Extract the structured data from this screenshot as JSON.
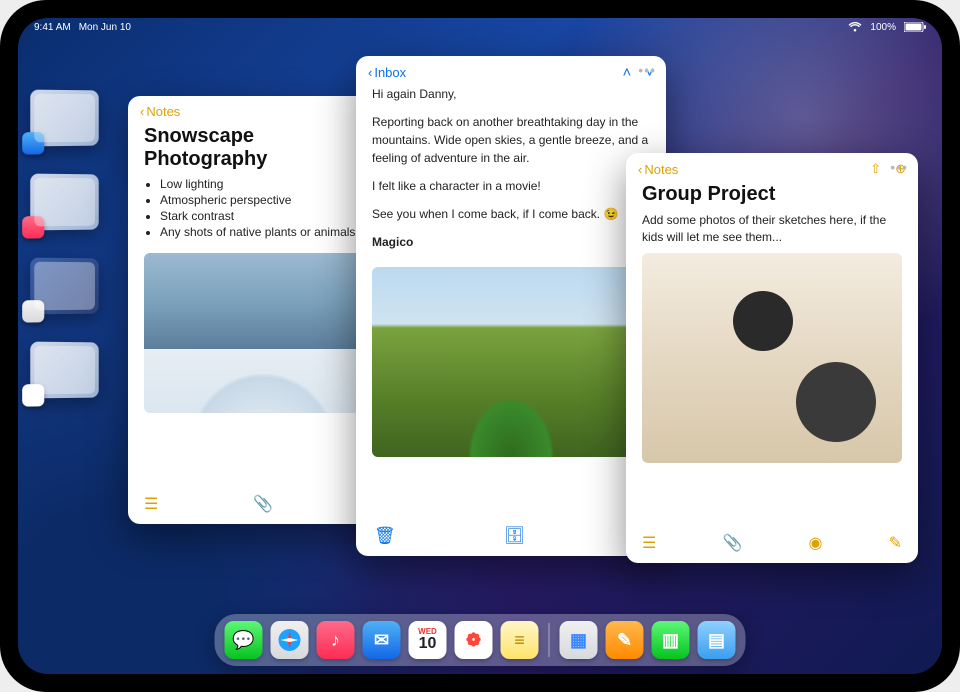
{
  "status": {
    "time": "9:41 AM",
    "date": "Mon Jun 10",
    "battery_pct": "100%"
  },
  "stage_badges": [
    {
      "name": "mail",
      "bg": "linear-gradient(180deg,#4fb1f7,#1368e6)"
    },
    {
      "name": "music",
      "bg": "linear-gradient(180deg,#ff6a8a,#fc2d55)"
    },
    {
      "name": "files",
      "bg": "linear-gradient(180deg,#f0f0f0,#d7d9dd)"
    },
    {
      "name": "photos",
      "bg": "linear-gradient(180deg,#ffd36a,#ff944d)"
    }
  ],
  "note1": {
    "back": "Notes",
    "title": "Snowscape Photography",
    "bullets": [
      "Low lighting",
      "Atmospheric perspective",
      "Stark contrast",
      "Any shots of native plants or animals"
    ]
  },
  "mail": {
    "back": "Inbox",
    "greeting": "Hi again Danny,",
    "p1": "Reporting back on another breathtaking day in the mountains. Wide open skies, a gentle breeze, and a feeling of adventure in the air.",
    "p2": "I felt like a character in a movie!",
    "p3": "See you when I come back, if I come back. 😉",
    "sig": "Magico"
  },
  "note2": {
    "back": "Notes",
    "title": "Group Project",
    "body": "Add some photos of their sketches here, if the kids will let me see them..."
  },
  "dock": {
    "cal_label": "WED",
    "cal_day": "10",
    "apps": [
      {
        "name": "messages",
        "bg": "linear-gradient(180deg,#5df777,#07c31f)",
        "glyph": "✉"
      },
      {
        "name": "safari",
        "bg": "linear-gradient(180deg,#5ac8fa,#0a84ff)",
        "glyph": "✦"
      },
      {
        "name": "music",
        "bg": "linear-gradient(180deg,#ff6a8a,#fc2d55)",
        "glyph": "♪"
      },
      {
        "name": "mail",
        "bg": "linear-gradient(180deg,#4fb1f7,#1368e6)",
        "glyph": "✉"
      },
      {
        "name": "calendar",
        "bg": "#fff",
        "glyph": ""
      },
      {
        "name": "photos",
        "bg": "#fff",
        "glyph": "❁"
      },
      {
        "name": "notes",
        "bg": "linear-gradient(180deg,#fff6c8,#ffe46b)",
        "glyph": "≡"
      },
      {
        "name": "freeform",
        "bg": "linear-gradient(180deg,#6fe3ff,#19a7e6)",
        "glyph": "✎"
      },
      {
        "name": "pages",
        "bg": "linear-gradient(180deg,#ffb84d,#ff8a00)",
        "glyph": "✎"
      },
      {
        "name": "numbers",
        "bg": "linear-gradient(180deg,#5df777,#07c31f)",
        "glyph": "▥"
      },
      {
        "name": "files",
        "bg": "linear-gradient(180deg,#8fd0ff,#3b9ef0)",
        "glyph": "▤"
      }
    ]
  }
}
